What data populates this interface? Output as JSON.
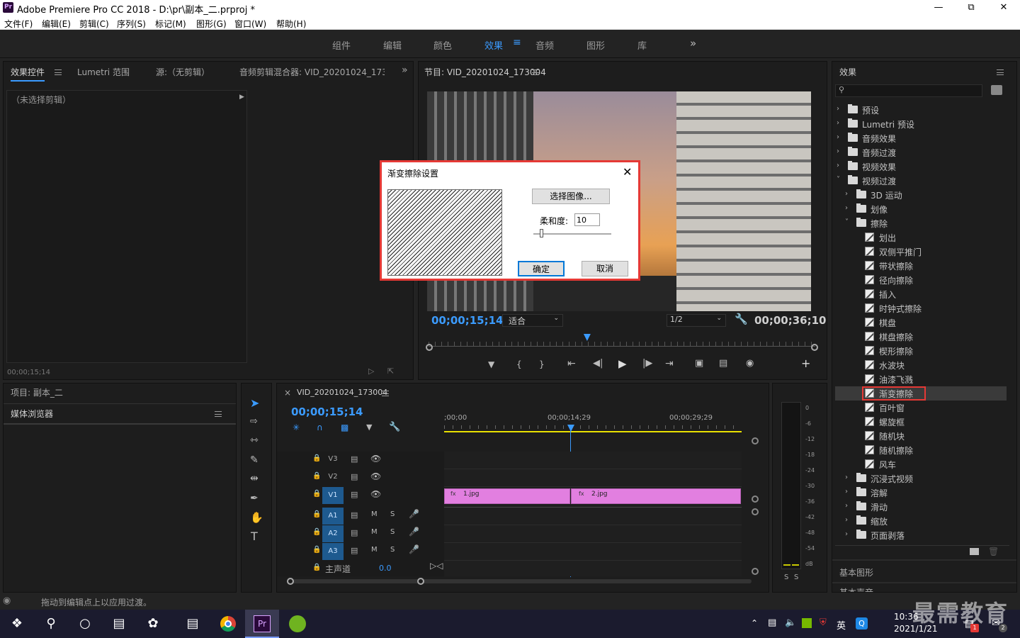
{
  "window": {
    "title": "Adobe Premiere Pro CC 2018 - D:\\pr\\副本_二.prproj *",
    "logo": "Pr"
  },
  "menu": [
    "文件(F)",
    "编辑(E)",
    "剪辑(C)",
    "序列(S)",
    "标记(M)",
    "图形(G)",
    "窗口(W)",
    "帮助(H)"
  ],
  "workspaces": [
    "组件",
    "编辑",
    "颜色",
    "效果",
    "音频",
    "图形",
    "库"
  ],
  "workspace_active": "效果",
  "left_panel": {
    "tabs": [
      "效果控件",
      "Lumetri 范围",
      "源:（无剪辑）",
      "音频剪辑混合器: VID_20201024_173004"
    ],
    "no_clip": "（未选择剪辑）",
    "timecode": "00;00;15;14"
  },
  "program": {
    "title": "节目: VID_20201024_173004",
    "timecode": "00;00;15;14",
    "fit": "适合",
    "quality": "1/2",
    "duration": "00;00;36;10",
    "playhead_fraction": 0.41
  },
  "dialog": {
    "title": "渐变擦除设置",
    "select_image": "选择图像...",
    "softness_label": "柔和度:",
    "softness_value": "10",
    "softness_fraction": 0.1,
    "ok": "确定",
    "cancel": "取消"
  },
  "project_panel": {
    "title": "项目: 副本_二",
    "media_browser": "媒体浏览器"
  },
  "timeline": {
    "sequence": "VID_20201024_173004",
    "timecode": "00;00;15;14",
    "ruler": [
      ";00;00",
      "00;00;14;29",
      "00;00;29;29"
    ],
    "tracks": [
      {
        "name": "V3",
        "type": "video"
      },
      {
        "name": "V2",
        "type": "video"
      },
      {
        "name": "V1",
        "type": "video",
        "active": true
      },
      {
        "name": "A1",
        "type": "audio"
      },
      {
        "name": "A2",
        "type": "audio"
      },
      {
        "name": "A3",
        "type": "audio"
      }
    ],
    "master": {
      "label": "主声道",
      "value": "0.0"
    },
    "clips": [
      {
        "name": "1.jpg"
      },
      {
        "name": "2.jpg"
      }
    ],
    "mute_label": "M",
    "solo_label": "S"
  },
  "audio_meter": {
    "scale": [
      "0",
      "-6",
      "-12",
      "-18",
      "-24",
      "-30",
      "-36",
      "-42",
      "-48",
      "-54",
      "dB"
    ],
    "solo": [
      "S",
      "S"
    ]
  },
  "effects": {
    "title": "效果",
    "items": [
      {
        "label": "预设",
        "kind": "folder",
        "arrow": ">"
      },
      {
        "label": "Lumetri 预设",
        "kind": "folder",
        "arrow": ">"
      },
      {
        "label": "音频效果",
        "kind": "folder",
        "arrow": ">"
      },
      {
        "label": "音频过渡",
        "kind": "folder",
        "arrow": ">"
      },
      {
        "label": "视频效果",
        "kind": "folder",
        "arrow": ">"
      },
      {
        "label": "视频过渡",
        "kind": "folder",
        "arrow": "v"
      },
      {
        "label": "3D 运动",
        "kind": "folder",
        "arrow": ">",
        "indent": 1
      },
      {
        "label": "划像",
        "kind": "folder",
        "arrow": ">",
        "indent": 1
      },
      {
        "label": "擦除",
        "kind": "folder",
        "arrow": "v",
        "indent": 1
      },
      {
        "label": "划出",
        "kind": "effect"
      },
      {
        "label": "双侧平推门",
        "kind": "effect"
      },
      {
        "label": "带状擦除",
        "kind": "effect"
      },
      {
        "label": "径向擦除",
        "kind": "effect"
      },
      {
        "label": "插入",
        "kind": "effect"
      },
      {
        "label": "时钟式擦除",
        "kind": "effect"
      },
      {
        "label": "棋盘",
        "kind": "effect"
      },
      {
        "label": "棋盘擦除",
        "kind": "effect"
      },
      {
        "label": "楔形擦除",
        "kind": "effect"
      },
      {
        "label": "水波块",
        "kind": "effect"
      },
      {
        "label": "油漆飞溅",
        "kind": "effect"
      },
      {
        "label": "渐变擦除",
        "kind": "effect",
        "selected": true
      },
      {
        "label": "百叶窗",
        "kind": "effect"
      },
      {
        "label": "螺旋框",
        "kind": "effect"
      },
      {
        "label": "随机块",
        "kind": "effect"
      },
      {
        "label": "随机擦除",
        "kind": "effect"
      },
      {
        "label": "风车",
        "kind": "effect"
      },
      {
        "label": "沉浸式视频",
        "kind": "folder",
        "arrow": ">",
        "indent": 1
      },
      {
        "label": "溶解",
        "kind": "folder",
        "arrow": ">",
        "indent": 1
      },
      {
        "label": "滑动",
        "kind": "folder",
        "arrow": ">",
        "indent": 1
      },
      {
        "label": "缩放",
        "kind": "folder",
        "arrow": ">",
        "indent": 1
      },
      {
        "label": "页面剥落",
        "kind": "folder",
        "arrow": ">",
        "indent": 1
      }
    ],
    "basic_graphics": "基本图形",
    "basic_sound": "基本声音"
  },
  "status": "拖动到编辑点上以应用过渡。",
  "tray": {
    "ime": "英",
    "time": "10:36",
    "date": "2021/1/21",
    "badge1": "1",
    "badge2": "2"
  },
  "watermark": "最需教育",
  "colors": {
    "accent": "#3b9bff",
    "clip": "#e27fe0",
    "highlight": "#e53935"
  },
  "icons": [
    "pr-logo-icon",
    "minimize-icon",
    "maximize-icon",
    "close-icon",
    "search-icon",
    "folder-icon",
    "effect-icon",
    "wrench-icon",
    "play-icon",
    "camera-icon",
    "lock-icon",
    "eye-icon",
    "mic-icon",
    "selection-tool-icon",
    "pen-tool-icon",
    "hand-tool-icon",
    "type-tool-icon",
    "windows-start-icon",
    "chrome-icon"
  ]
}
